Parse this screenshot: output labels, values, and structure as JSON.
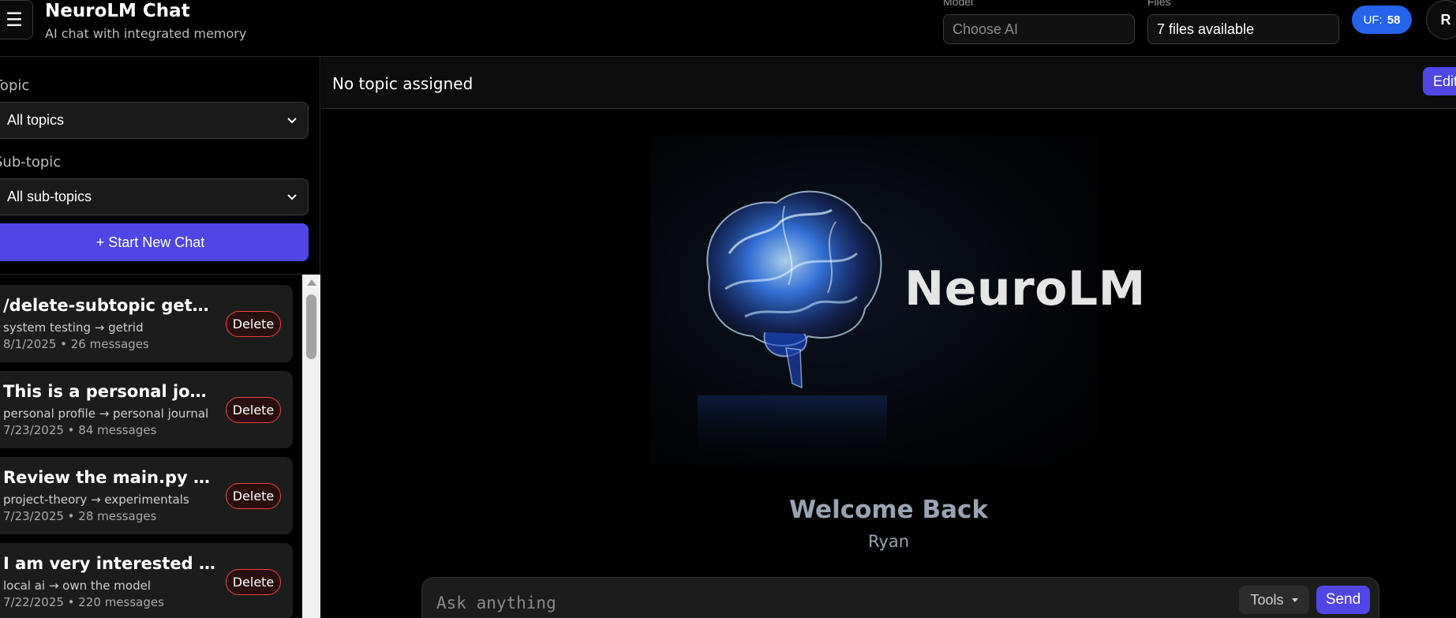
{
  "header": {
    "menu_glyph": "☰",
    "title": "NeuroLM Chat",
    "subtitle": "AI chat with integrated memory",
    "model": {
      "label": "Model",
      "placeholder": "Choose AI"
    },
    "files": {
      "label": "Files",
      "value": "7 files available"
    },
    "uf_badge": {
      "label": "UF:",
      "count": "58"
    },
    "avatar_initial": "R"
  },
  "sidebar": {
    "topic": {
      "label": "Topic",
      "selected": "All topics"
    },
    "subtopic": {
      "label": "Sub-topic",
      "selected": "All sub-topics"
    },
    "new_chat_label": "+ Start New Chat",
    "chats": [
      {
        "title": "/delete-subtopic getrid",
        "path": "system testing → getrid",
        "meta": "8/1/2025 • 26 messages",
        "delete_label": "Delete"
      },
      {
        "title": "This is a personal journal c...",
        "path": "personal profile → personal journal",
        "meta": "7/23/2025 • 84 messages",
        "delete_label": "Delete"
      },
      {
        "title": "Review the main.py file an...",
        "path": "project-theory → experimentals",
        "meta": "7/23/2025 • 28 messages",
        "delete_label": "Delete"
      },
      {
        "title": "I am very interested in ow...",
        "path": "local ai → own the model",
        "meta": "7/22/2025 • 220 messages",
        "delete_label": "Delete"
      }
    ]
  },
  "main": {
    "topic_status": "No topic assigned",
    "edit_label": "Edit",
    "hero_brand": "NeuroLM",
    "welcome_title": "Welcome Back",
    "welcome_name": "Ryan",
    "composer": {
      "placeholder": "Ask anything",
      "tools_label": "Tools",
      "send_label": "Send"
    }
  },
  "colors": {
    "accent": "#4f46e5",
    "badge_blue": "#2563eb",
    "delete_red": "#ef4444"
  }
}
